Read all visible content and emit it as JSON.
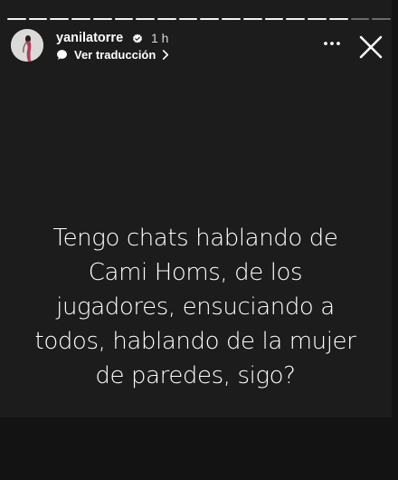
{
  "header": {
    "username": "yanilatorre",
    "time_ago": "1 h",
    "translate_label": "Ver traducción",
    "progress_segments": 18,
    "progress_completed": 16
  },
  "icons": {
    "avatar": "avatar",
    "verified": "verified-badge-icon",
    "translate": "translate-icon",
    "chevron": "chevron-right-icon",
    "more": "more-options-icon",
    "close": "close-icon"
  },
  "story": {
    "text_lines": [
      "Tengo chats hablando de",
      "Cami Homs, de los",
      "jugadores, ensuciando a",
      "todos, hablando de la mujer",
      "de paredes, sigo?"
    ]
  },
  "colors": {
    "background": "#131313",
    "card": "#1c1c1c",
    "text": "#ffffff"
  }
}
